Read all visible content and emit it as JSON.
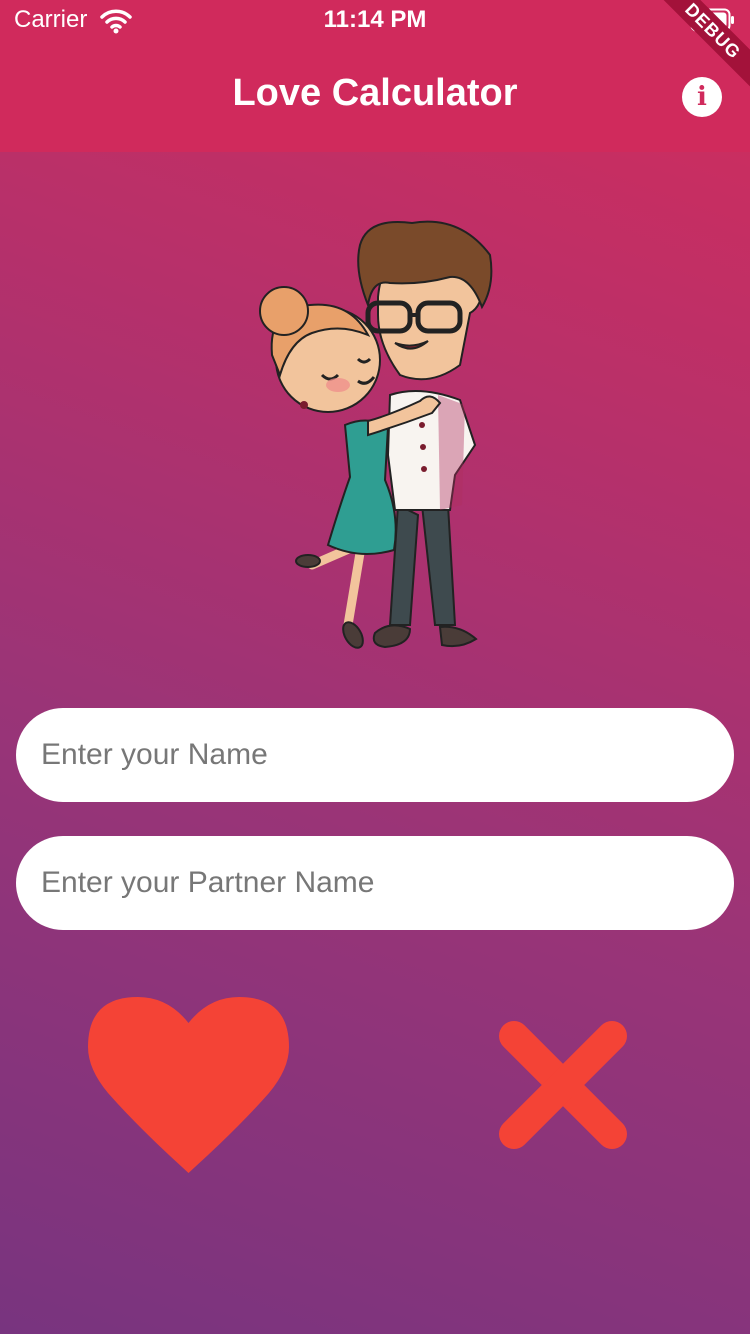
{
  "status_bar": {
    "carrier": "Carrier",
    "time": "11:14 PM"
  },
  "app_bar": {
    "title": "Love Calculator",
    "info_icon": "i",
    "debug_label": "DEBUG"
  },
  "form": {
    "name_placeholder": "Enter your Name",
    "partner_placeholder": "Enter your Partner Name"
  },
  "actions": {
    "calculate_icon": "heart-icon",
    "clear_icon": "close-icon"
  },
  "colors": {
    "app_bar": "#d02a5c",
    "gradient_top": "#d22d5c",
    "gradient_bottom": "#78347f",
    "accent_red": "#f44336"
  }
}
